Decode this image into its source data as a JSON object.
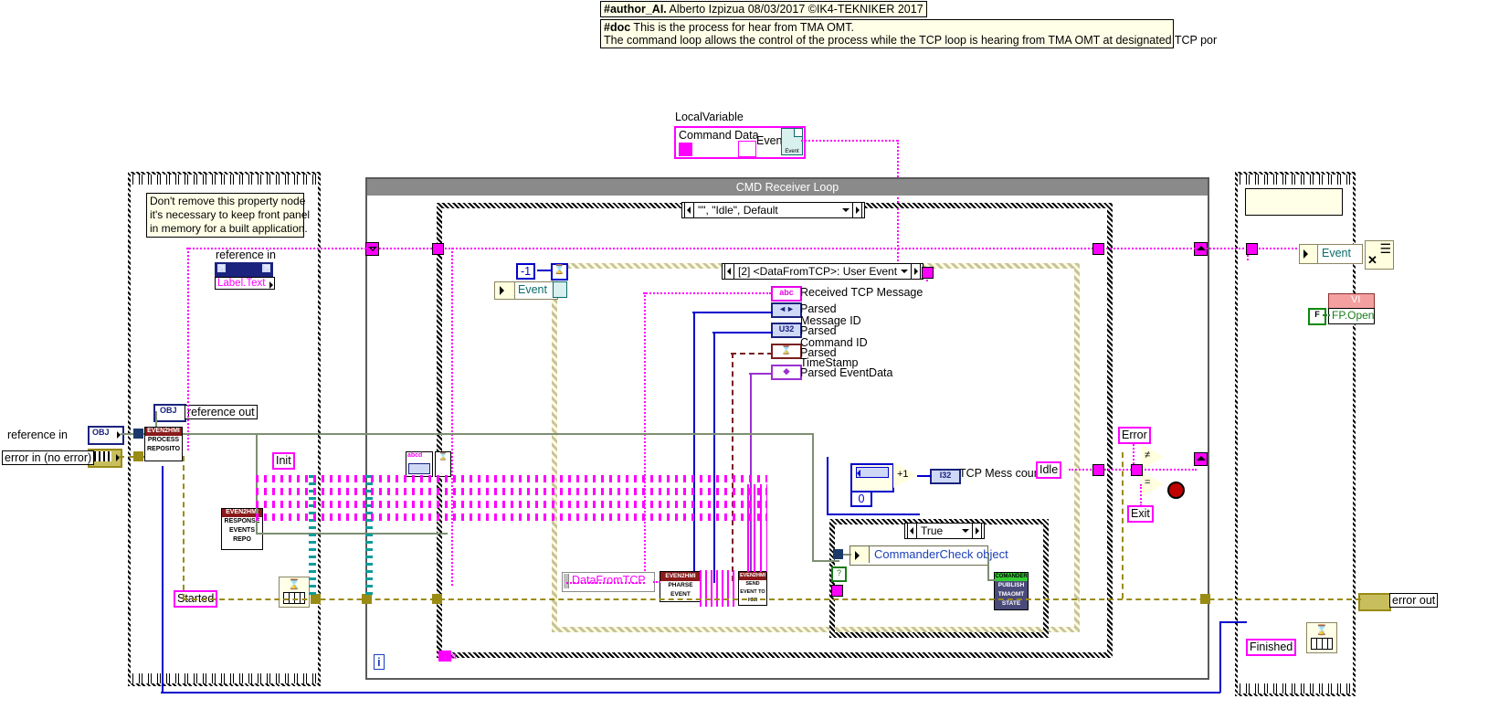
{
  "diagram": {
    "kind": "labview-block-diagram",
    "title_banner": "CMD Receiver Loop"
  },
  "annotations": {
    "author_tag": "#author_AI.",
    "author_text": " Alberto Izpizua 08/03/2017 ©IK4-TEKNIKER 2017",
    "doc_tag": "#doc",
    "doc_line1": " This is the process for hear from TMA OMT.",
    "doc_line2": "The command loop allows the control of the process while the TCP loop is hearing from TMA OMT at designated TCP por",
    "property_note_line1": "Don't remove this property node",
    "property_note_line2": "it's necessary to keep front panel",
    "property_note_line3": "in memory for a built application."
  },
  "left_panel": {
    "reference_in_label": "reference in",
    "property_node": "Label.Text",
    "terminal_glyph": "?!"
  },
  "terminals": {
    "reference_in": "reference in",
    "reference_in_type": "OBJ",
    "error_in": "error in (no error)",
    "reference_out": "reference out",
    "reference_out_type": "OBJ",
    "error_out": "error out"
  },
  "local_variable": {
    "caption": "LocalVariable",
    "name": "Command Data",
    "event_label": "Event",
    "icon_text": "Event"
  },
  "loop": {
    "banner": "CMD Receiver Loop",
    "case_selector": "\"\", \"Idle\", Default",
    "event_selector": "[2] <DataFromTCP>: User Event",
    "inner_case_true": "True",
    "loop_index": "i"
  },
  "event_outputs": [
    {
      "type": "abc",
      "label": "Received TCP Message",
      "color": "#FF00FF"
    },
    {
      "type": "◄►",
      "label": "Parsed",
      "color": "#0000CC"
    },
    {
      "type": "U32",
      "label": "Message ID",
      "sub": "Parsed",
      "color": "#0000CC"
    },
    {
      "type": "⌛",
      "label": "Command ID",
      "sub": "Parsed",
      "color": "#7a1f1f"
    },
    {
      "type": "◆",
      "label": "TimeStamp",
      "sub": "Parsed EventData",
      "color": "#9b30d0"
    }
  ],
  "nodes": {
    "init": "Init",
    "started": "Started",
    "finished": "Finished",
    "idle": "Idle",
    "error": "Error",
    "exit": "Exit",
    "data_from_tcp": "DataFromTCP",
    "commander_check": "CommanderCheck object",
    "tcp_counter_label": "TCP Mess counte",
    "tcp_counter_type": "I32",
    "counter_seed": "0",
    "increment": "+1",
    "event_ref": "Event",
    "minus_one": "-1",
    "event_in_label": "Event",
    "fp_open": "FP.Open",
    "fp_open_flag": "F",
    "vi_ref_glyph": "VI"
  },
  "subvi_icons": {
    "process_repo": {
      "top": "EVEN2HMI",
      "line1": "PROCESS",
      "line2": "REPOSITO"
    },
    "response_repo": {
      "top": "EVEN2HMI",
      "line1": "RESPONSE",
      "line2": "EVENTS",
      "line3": "REPO"
    },
    "pharse_event": {
      "top": "EVEN2HMI",
      "line1": "PHARSE",
      "line2": "EVENT"
    },
    "send_event": {
      "top": "EVEN2HMI",
      "line1": "SEND",
      "line2": "EVENT TO",
      "line3": "HMI"
    },
    "publish_state": {
      "top": "COMANDER",
      "line1": "PUBLISH",
      "line2": "TMAOMT",
      "line3": "STATE"
    }
  },
  "colors": {
    "pink_wire": "#FF00FF",
    "blue_wire": "#0000CC",
    "green_wire": "#7d8f73",
    "yellow_error_wire": "#9a8b15",
    "loop_gray": "#8a8a8a",
    "comment_bg": "#FFFFE8",
    "subvi_bg": "#FFFFE0"
  }
}
